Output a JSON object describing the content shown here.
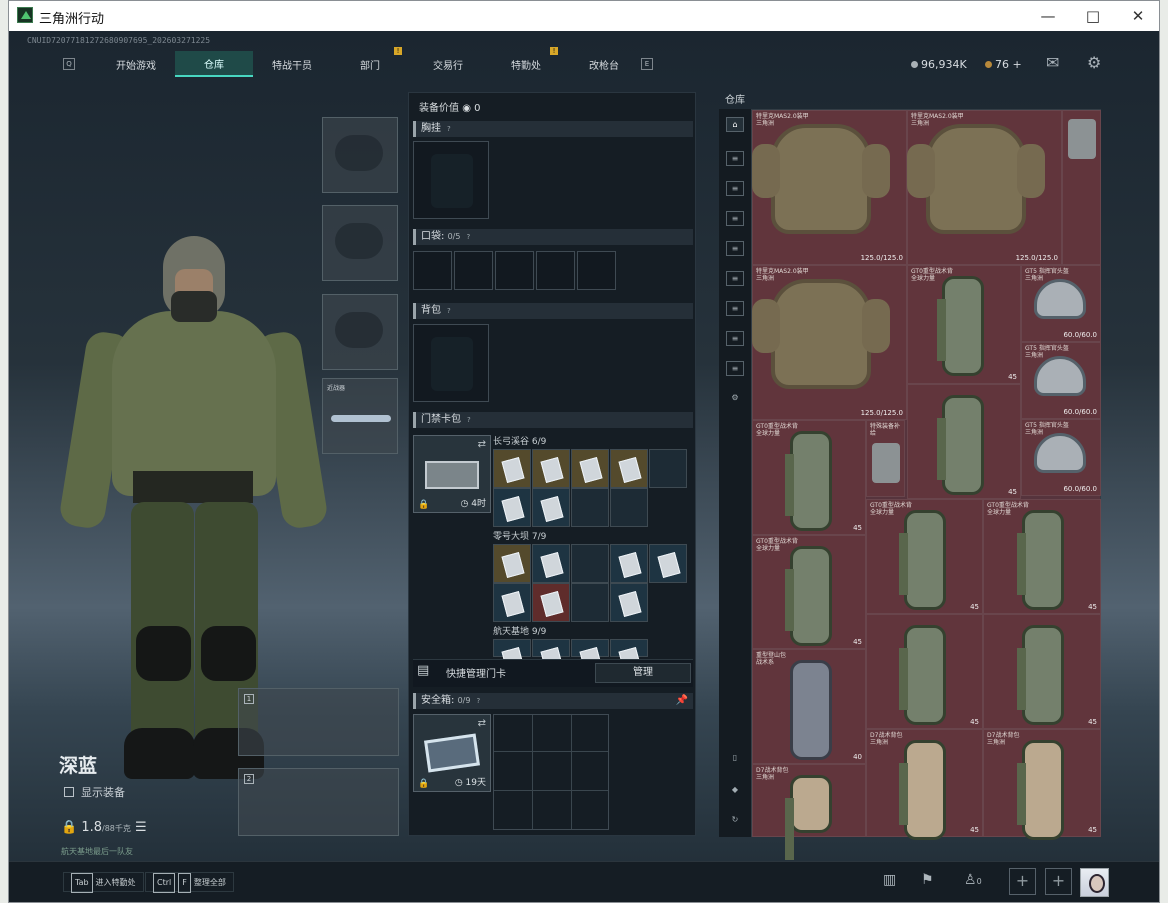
{
  "window": {
    "title": "三角洲行动",
    "minimize": "—",
    "maximize": "□",
    "close": "✕"
  },
  "uid": "CNUID72077181272680907695_202603271225",
  "nav": {
    "left_key": "Q",
    "right_key": "E",
    "tabs": [
      "开始游戏",
      "仓库",
      "特战干员",
      "部门",
      "交易行",
      "特勤处",
      "改枪台"
    ],
    "active": "仓库",
    "notices": [
      "!",
      "!"
    ]
  },
  "currency": {
    "coins": "96,934K",
    "tickets": "76 +"
  },
  "character": {
    "name": "深蓝",
    "show_gear": "显示装备",
    "weight": "1.8",
    "weight_max": "/88千克",
    "status": "航天基地最后一队友",
    "slot1": "1",
    "slot2": "2",
    "melee": "近战器"
  },
  "loadout": {
    "value_label": "装备价值",
    "value": "0",
    "chest": "胸挂",
    "pocket": "口袋:",
    "pocket_count": "0/5",
    "backpack": "背包",
    "keycard": "门禁卡包",
    "keycard_time": "4时",
    "zones": [
      "长弓溪谷 6/9",
      "零号大坝 7/9",
      "航天基地 9/9"
    ],
    "manage_label": "快捷管理门卡",
    "manage_button": "管理",
    "safebox": "安全箱:",
    "safebox_count": "0/9",
    "safebox_time": "19天"
  },
  "storage": {
    "title": "仓库",
    "items": [
      {
        "name": "特里克MAS2.0装甲",
        "sub": "三角洲",
        "value": "125.0/125.0"
      },
      {
        "name": "特里克MAS2.0装甲",
        "sub": "三角洲",
        "value": "125.0/125.0"
      },
      {
        "name": "特里克MAS2.0装甲",
        "sub": "三角洲",
        "value": "125.0/125.0"
      },
      {
        "name": "GT0重型战术背",
        "sub": "全球力量",
        "value": "45"
      },
      {
        "name": "GT5 指挥官头盔",
        "sub": "三角洲",
        "value": "60.0/60.0"
      },
      {
        "name": "GT5 指挥官头盔",
        "sub": "三角洲",
        "value": "60.0/60.0"
      },
      {
        "name": "GT0重型战术背",
        "sub": "全球力量",
        "value": "45"
      },
      {
        "name": "特殊装备补给",
        "sub": "",
        "value": ""
      },
      {
        "name": "GT5 指挥官头盔",
        "sub": "三角洲",
        "value": "60.0/60.0"
      },
      {
        "name": "GT0重型战术背",
        "sub": "全球力量",
        "value": "45"
      },
      {
        "name": "GT0重型战术背",
        "sub": "全球力量",
        "value": "45"
      },
      {
        "name": "GT0重型战术背",
        "sub": "全球力量",
        "value": "45"
      },
      {
        "name": "重型登山包",
        "sub": "战术系",
        "value": "40"
      },
      {
        "name": "D7战术背包",
        "sub": "三角洲",
        "value": "45"
      },
      {
        "name": "D7战术背包",
        "sub": "三角洲",
        "value": "45"
      },
      {
        "name": "D7战术背包",
        "sub": "三角洲",
        "value": "45"
      }
    ]
  },
  "bottom": {
    "tab_key": "Tab",
    "tab_label": "进入特勤处",
    "ctrl_key": "Ctrl",
    "f_key": "F",
    "ctrl_label": "整理全部",
    "squad": "0"
  }
}
